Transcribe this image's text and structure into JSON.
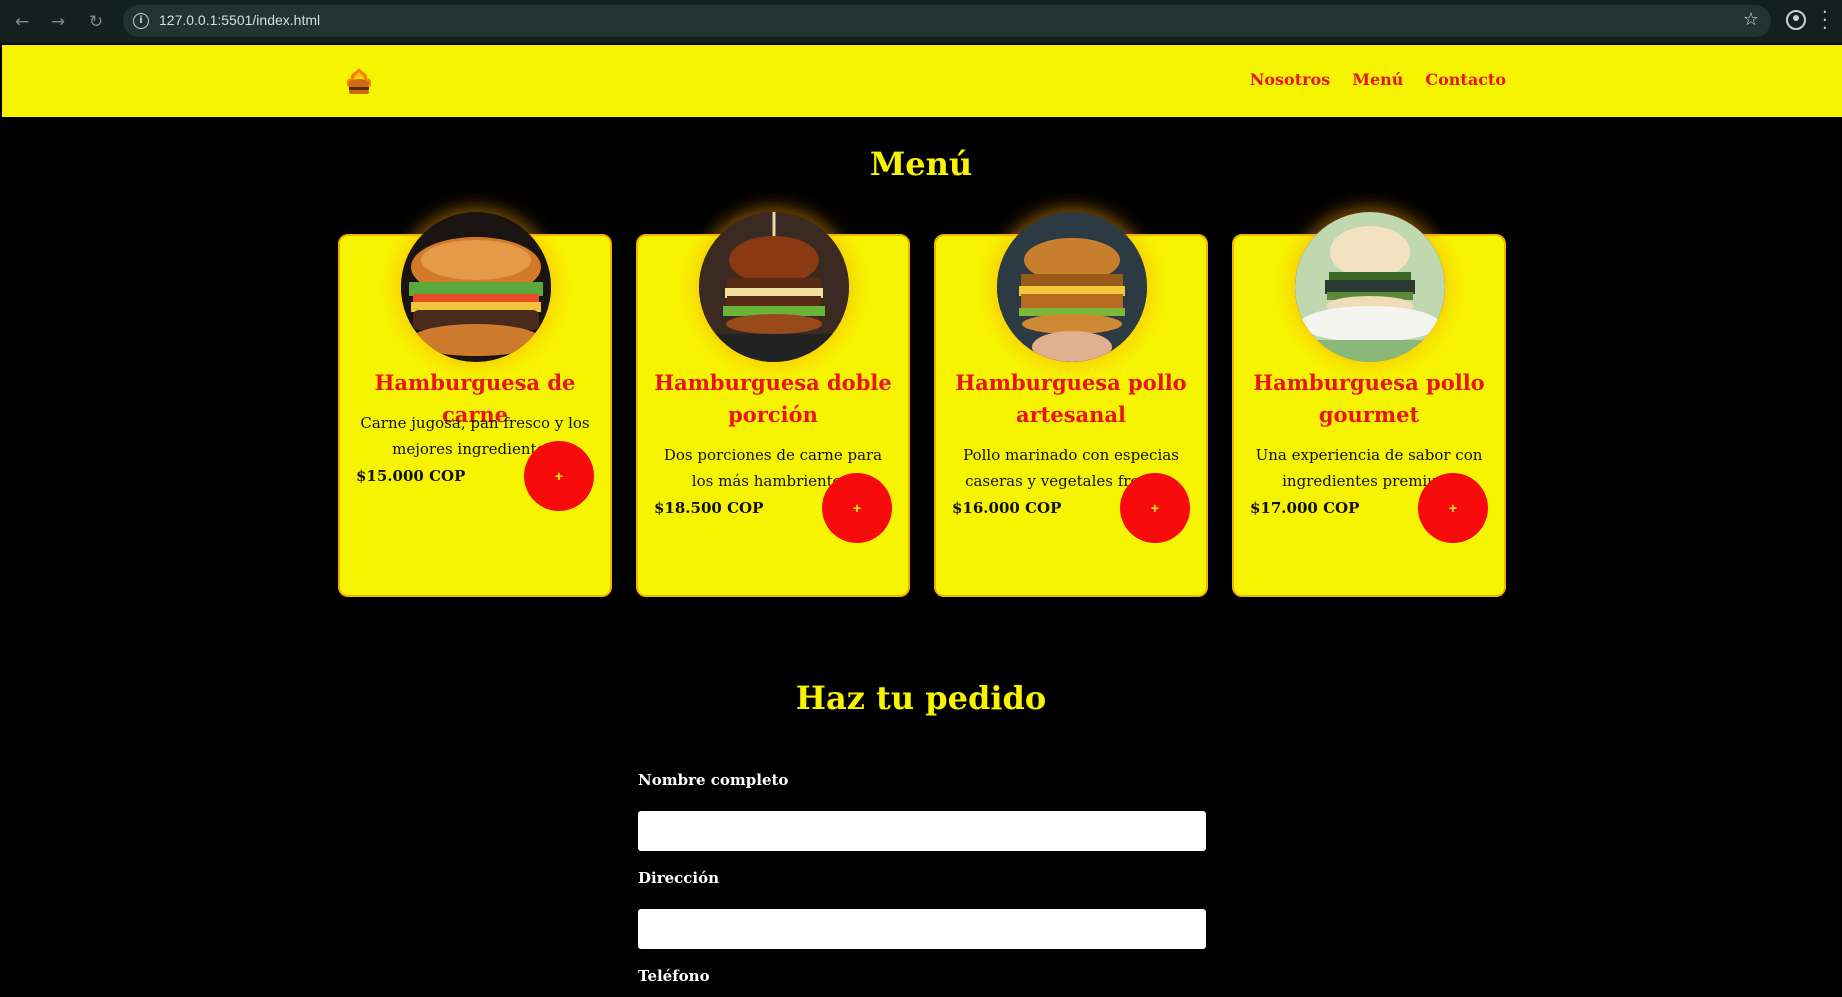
{
  "browser": {
    "url": "127.0.0.1:5501/index.html"
  },
  "header": {
    "logo_icon": "burger-flame-logo",
    "nav": [
      "Nosotros",
      "Menú",
      "Contacto"
    ]
  },
  "menu": {
    "title": "Menú",
    "items": [
      {
        "name": "Hamburguesa de carne",
        "description": "Carne jugosa, pan fresco y los mejores ingredientes.",
        "price": "$15.000 COP",
        "button": "+"
      },
      {
        "name": "Hamburguesa doble porción",
        "description": "Dos porciones de carne para los más hambrientos.",
        "price": "$18.500 COP",
        "button": "+"
      },
      {
        "name": "Hamburguesa pollo artesanal",
        "description": "Pollo marinado con especias caseras y vegetales frescos.",
        "price": "$16.000 COP",
        "button": "+"
      },
      {
        "name": "Hamburguesa pollo gourmet",
        "description": "Una experiencia de sabor con ingredientes premium.",
        "price": "$17.000 COP",
        "button": "+"
      }
    ]
  },
  "order": {
    "title": "Haz tu pedido",
    "fields": [
      {
        "label": "Nombre completo",
        "value": ""
      },
      {
        "label": "Dirección",
        "value": ""
      },
      {
        "label": "Teléfono",
        "value": ""
      }
    ]
  },
  "colors": {
    "accent_yellow": "#f7f402",
    "accent_red": "#e8161b",
    "background": "#000000"
  }
}
